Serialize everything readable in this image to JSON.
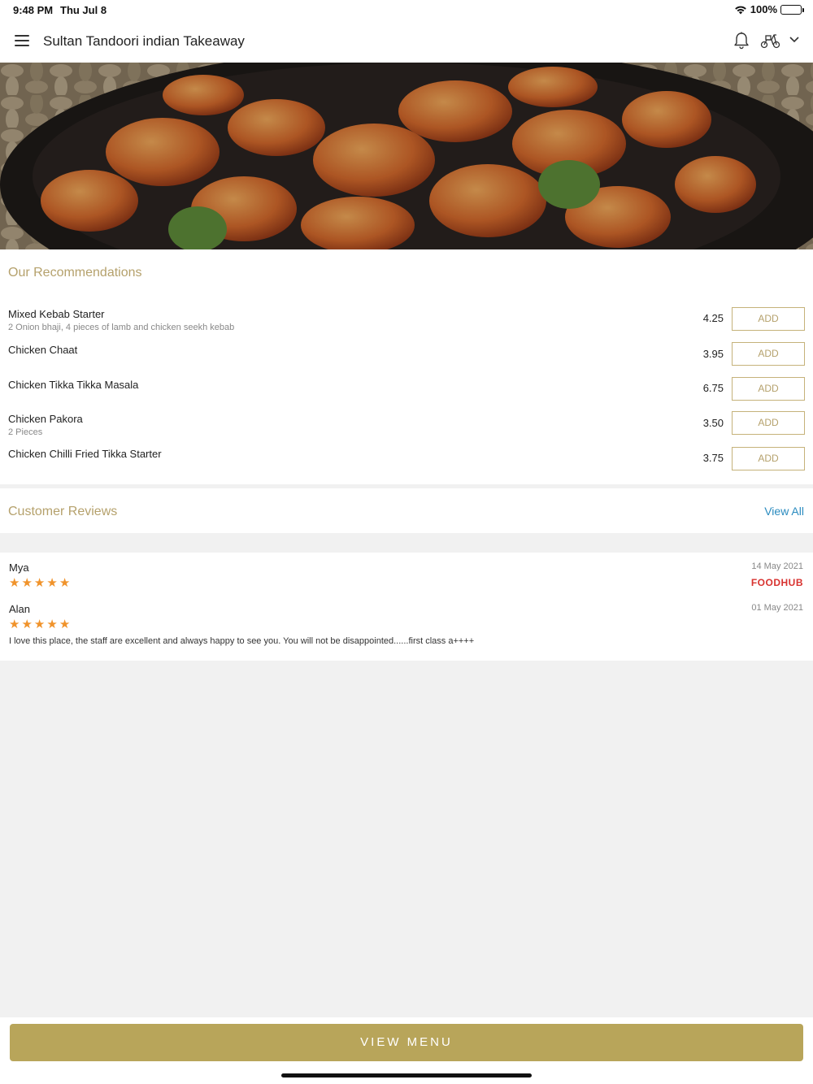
{
  "status": {
    "time": "9:48 PM",
    "date": "Thu Jul 8",
    "battery": "100%"
  },
  "header": {
    "title": "Sultan Tandoori indian Takeaway"
  },
  "recommendations": {
    "title": "Our Recommendations",
    "items": [
      {
        "name": "Mixed Kebab Starter",
        "desc": "2 Onion bhaji, 4 pieces of lamb and chicken seekh kebab",
        "price": "4.25",
        "button": "ADD"
      },
      {
        "name": "Chicken Chaat",
        "desc": "",
        "price": "3.95",
        "button": "ADD"
      },
      {
        "name": "Chicken Tikka Tikka Masala",
        "desc": "",
        "price": "6.75",
        "button": "ADD"
      },
      {
        "name": "Chicken Pakora",
        "desc": "2 Pieces",
        "price": "3.50",
        "button": "ADD"
      },
      {
        "name": "Chicken Chilli Fried Tikka Starter",
        "desc": "",
        "price": "3.75",
        "button": "ADD"
      }
    ]
  },
  "reviews": {
    "title": "Customer Reviews",
    "view_all": "View All",
    "items": [
      {
        "name": "Mya",
        "date": "14 May 2021",
        "rating": 5,
        "source": "FOODHUB",
        "text": ""
      },
      {
        "name": "Alan",
        "date": "01 May 2021",
        "rating": 5,
        "source": "",
        "text": "I love this place, the staff are excellent and always happy to see you. You will not be disappointed......first class a++++"
      }
    ]
  },
  "footer": {
    "view_menu": "VIEW MENU"
  },
  "colors": {
    "accent": "#b5a16c",
    "button": "#b8a55a",
    "link": "#2a8bbf",
    "star": "#f0932b",
    "brand": "#d8322f"
  }
}
